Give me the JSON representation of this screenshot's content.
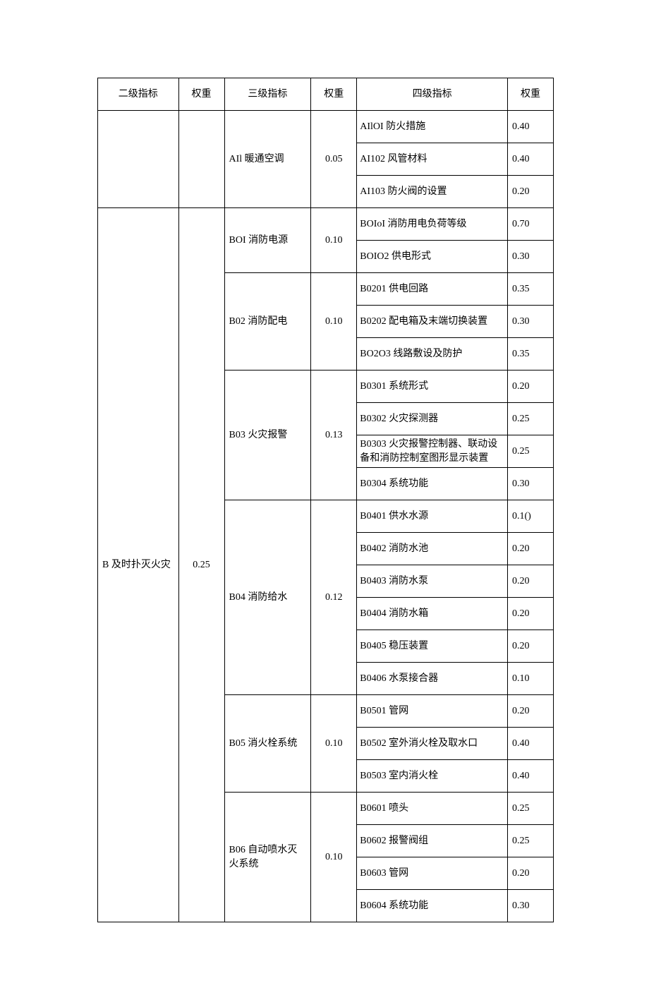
{
  "headers": {
    "c1": "二级指标",
    "c2": "权重",
    "c3": "三级指标",
    "c4": "权重",
    "c5": "四级指标",
    "c6": "权重"
  },
  "groups": [
    {
      "name": "",
      "weight": "",
      "subgroups": [
        {
          "name": "AIl 暖通空调",
          "weight": "0.05",
          "items": [
            {
              "label": "AIlOI 防火措施",
              "weight": "0.40"
            },
            {
              "label": "AI102 风管材料",
              "weight": "0.40"
            },
            {
              "label": "AI103 防火阀的设置",
              "weight": "0.20"
            }
          ]
        }
      ]
    },
    {
      "name": "B 及时扑灭火灾",
      "weight": "0.25",
      "subgroups": [
        {
          "name": "BOI 消防电源",
          "weight": "0.10",
          "items": [
            {
              "label": "BOIoI 消防用电负荷等级",
              "weight": "0.70"
            },
            {
              "label": "BOIO2 供电形式",
              "weight": "0.30"
            }
          ]
        },
        {
          "name": "B02 消防配电",
          "weight": "0.10",
          "items": [
            {
              "label": "B0201 供电回路",
              "weight": "0.35"
            },
            {
              "label": "B0202 配电箱及末端切换装置",
              "weight": "0.30"
            },
            {
              "label": "BO2O3 线路敷设及防护",
              "weight": "0.35"
            }
          ]
        },
        {
          "name": "B03 火灾报警",
          "weight": "0.13",
          "items": [
            {
              "label": "B0301 系统形式",
              "weight": "0.20"
            },
            {
              "label": "B0302 火灾探测器",
              "weight": "0.25"
            },
            {
              "label": "B0303 火灾报警控制器、联动设备和消防控制室图形显示装置",
              "weight": "0.25"
            },
            {
              "label": "B0304 系统功能",
              "weight": "0.30"
            }
          ]
        },
        {
          "name": "B04 消防给水",
          "weight": "0.12",
          "items": [
            {
              "label": "B0401 供水水源",
              "weight": "0.1()"
            },
            {
              "label": "B0402 消防水池",
              "weight": "0.20"
            },
            {
              "label": "B0403 消防水泵",
              "weight": "0.20"
            },
            {
              "label": "B0404 消防水箱",
              "weight": "0.20"
            },
            {
              "label": "B0405 稳压装置",
              "weight": "0.20"
            },
            {
              "label": "B0406 水泵接合器",
              "weight": "0.10"
            }
          ]
        },
        {
          "name": "B05 消火栓系统",
          "weight": "0.10",
          "items": [
            {
              "label": "B0501 管网",
              "weight": "0.20"
            },
            {
              "label": "B0502 室外消火栓及取水口",
              "weight": "0.40"
            },
            {
              "label": "B0503 室内消火栓",
              "weight": "0.40"
            }
          ]
        },
        {
          "name": "B06 自动喷水灭火系统",
          "weight": "0.10",
          "items": [
            {
              "label": "B0601 喷头",
              "weight": "0.25"
            },
            {
              "label": "B0602 报警阀组",
              "weight": "0.25"
            },
            {
              "label": "B0603 管网",
              "weight": "0.20"
            },
            {
              "label": "B0604 系统功能",
              "weight": "0.30"
            }
          ]
        }
      ]
    }
  ]
}
